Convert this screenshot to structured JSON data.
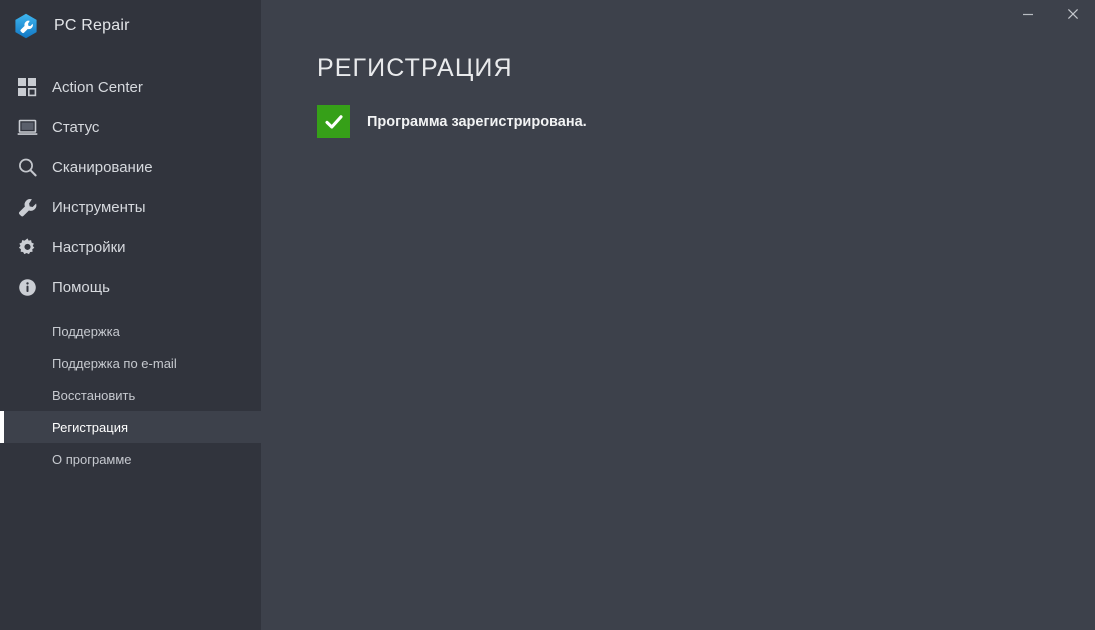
{
  "app": {
    "name": "PC Repair",
    "logo_icon": "hexagon-wrench-logo"
  },
  "titlebar": {
    "minimize_label": "Свернуть",
    "close_label": "Закрыть",
    "minimize_icon": "minimize-icon",
    "close_icon": "close-icon"
  },
  "sidebar": {
    "background_color": "#31343d",
    "accent_color": "#ffffff",
    "items": [
      {
        "label": "Action Center",
        "icon": "grid-squares-icon",
        "selected": false
      },
      {
        "label": "Статус",
        "icon": "monitor-icon",
        "selected": false
      },
      {
        "label": "Сканирование",
        "icon": "search-icon",
        "selected": false
      },
      {
        "label": "Инструменты",
        "icon": "wrench-icon",
        "selected": false
      },
      {
        "label": "Настройки",
        "icon": "gear-icon",
        "selected": false
      },
      {
        "label": "Помощь",
        "icon": "info-circle-icon",
        "selected": false
      }
    ],
    "subitems": [
      {
        "label": "Поддержка",
        "selected": false
      },
      {
        "label": "Поддержка по e-mail",
        "selected": false
      },
      {
        "label": "Восстановить",
        "selected": false
      },
      {
        "label": "Регистрация",
        "selected": true
      },
      {
        "label": "О программе",
        "selected": false
      }
    ]
  },
  "main": {
    "background_color": "#3d414b",
    "title": "РЕГИСТРАЦИЯ",
    "status": {
      "icon": "checkmark-icon",
      "badge_color": "#36a018",
      "text": "Программа зарегистрирована."
    }
  }
}
